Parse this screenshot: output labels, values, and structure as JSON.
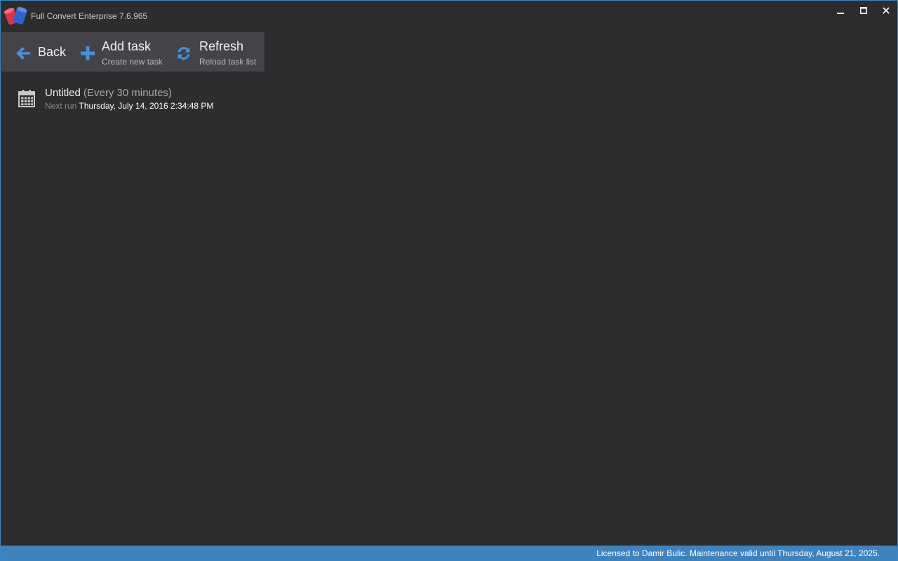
{
  "window": {
    "title": "Full Convert Enterprise 7.6.965",
    "accent_color": "#3f82bd",
    "background_color": "#2d2d30"
  },
  "toolbar": {
    "back": {
      "label": "Back",
      "icon": "arrow-left-icon"
    },
    "add_task": {
      "label": "Add task",
      "sublabel": "Create new task",
      "icon": "plus-icon"
    },
    "refresh": {
      "label": "Refresh",
      "sublabel": "Reload task list",
      "icon": "refresh-icon"
    }
  },
  "tasks": [
    {
      "name": "Untitled",
      "schedule": "(Every 30 minutes)",
      "next_run_label": "Next run",
      "next_run_value": "Thursday, July 14, 2016 2:34:48 PM",
      "icon": "calendar-icon"
    }
  ],
  "statusbar": {
    "text": "Licensed to Damir Bulic. Maintenance valid until Thursday, August 21, 2025."
  }
}
